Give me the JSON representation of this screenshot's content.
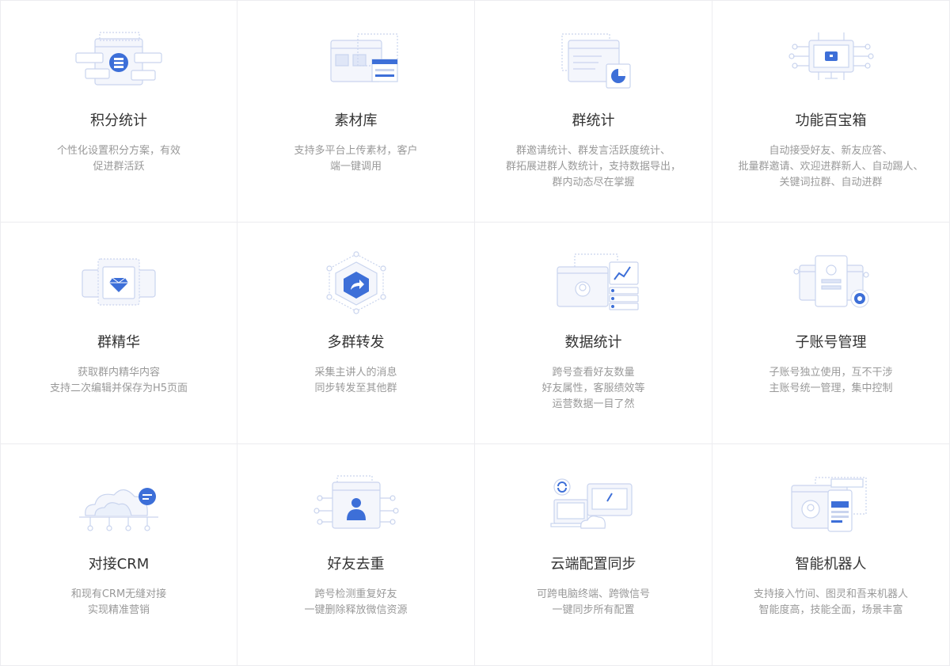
{
  "features": [
    {
      "icon": "points-stats-icon",
      "title": "积分统计",
      "desc": [
        "个性化设置积分方案，有效",
        "促进群活跃"
      ]
    },
    {
      "icon": "material-library-icon",
      "title": "素材库",
      "desc": [
        "支持多平台上传素材，客户",
        "端一键调用"
      ]
    },
    {
      "icon": "group-stats-icon",
      "title": "群统计",
      "desc": [
        "群邀请统计、群发言活跃度统计、",
        "群拓展进群人数统计，支持数据导出，",
        "群内动态尽在掌握"
      ]
    },
    {
      "icon": "toolbox-icon",
      "title": "功能百宝箱",
      "desc": [
        "自动接受好友、新友应答、",
        "批量群邀请、欢迎进群新人、自动踢人、",
        "关键词拉群、自动进群"
      ]
    },
    {
      "icon": "diamond-icon",
      "title": "群精华",
      "desc": [
        "获取群内精华内容",
        "支持二次编辑并保存为H5页面"
      ]
    },
    {
      "icon": "share-forward-icon",
      "title": "多群转发",
      "desc": [
        "采集主讲人的消息",
        "同步转发至其他群"
      ]
    },
    {
      "icon": "data-stats-icon",
      "title": "数据统计",
      "desc": [
        "跨号查看好友数量",
        "好友属性，客服绩效等",
        "运营数据一目了然"
      ]
    },
    {
      "icon": "sub-account-icon",
      "title": "子账号管理",
      "desc": [
        "子账号独立使用，互不干涉",
        "主账号统一管理，集中控制"
      ]
    },
    {
      "icon": "crm-cloud-icon",
      "title": "对接CRM",
      "desc": [
        "和现有CRM无缝对接",
        "实现精准营销"
      ]
    },
    {
      "icon": "friend-dedup-icon",
      "title": "好友去重",
      "desc": [
        "跨号检测重复好友",
        "一键删除释放微信资源"
      ]
    },
    {
      "icon": "cloud-sync-icon",
      "title": "云端配置同步",
      "desc": [
        "可跨电脑终端、跨微信号",
        "一键同步所有配置"
      ]
    },
    {
      "icon": "robot-icon",
      "title": "智能机器人",
      "desc": [
        "支持接入竹间、图灵和吾来机器人",
        "智能度高，技能全面，场景丰富"
      ]
    }
  ],
  "colors": {
    "accent": "#3d6fd8",
    "line": "#c9d4ee",
    "fill": "#eef2fb"
  }
}
